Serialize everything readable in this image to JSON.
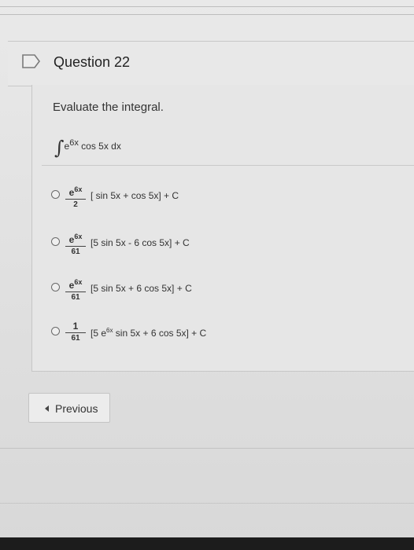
{
  "question": {
    "title": "Question 22",
    "flag_icon": "flag-icon"
  },
  "prompt": "Evaluate the integral.",
  "integral": {
    "sign": "∫",
    "base": "e",
    "exponent": "6x",
    "rest": " cos 5x dx"
  },
  "options": [
    {
      "num_base": "e",
      "num_exp": "6x",
      "den": "2",
      "rest": "[ sin 5x + cos 5x] + C"
    },
    {
      "num_base": "e",
      "num_exp": "6x",
      "den": "61",
      "rest": "[5 sin 5x - 6 cos 5x] + C"
    },
    {
      "num_base": "e",
      "num_exp": "6x",
      "den": "61",
      "rest": "[5 sin 5x + 6 cos 5x] + C"
    },
    {
      "num_base": "",
      "num_exp": "",
      "num_plain": "1",
      "den": "61",
      "rest_pre": "[5 e",
      "rest_exp": "6x",
      "rest_post": " sin 5x + 6 cos 5x] + C"
    }
  ],
  "navigation": {
    "previous_label": "Previous"
  },
  "colors": {
    "background": "#e2e2e2",
    "text": "#2b2b2b",
    "bottom_bar": "#1c1c1c"
  }
}
